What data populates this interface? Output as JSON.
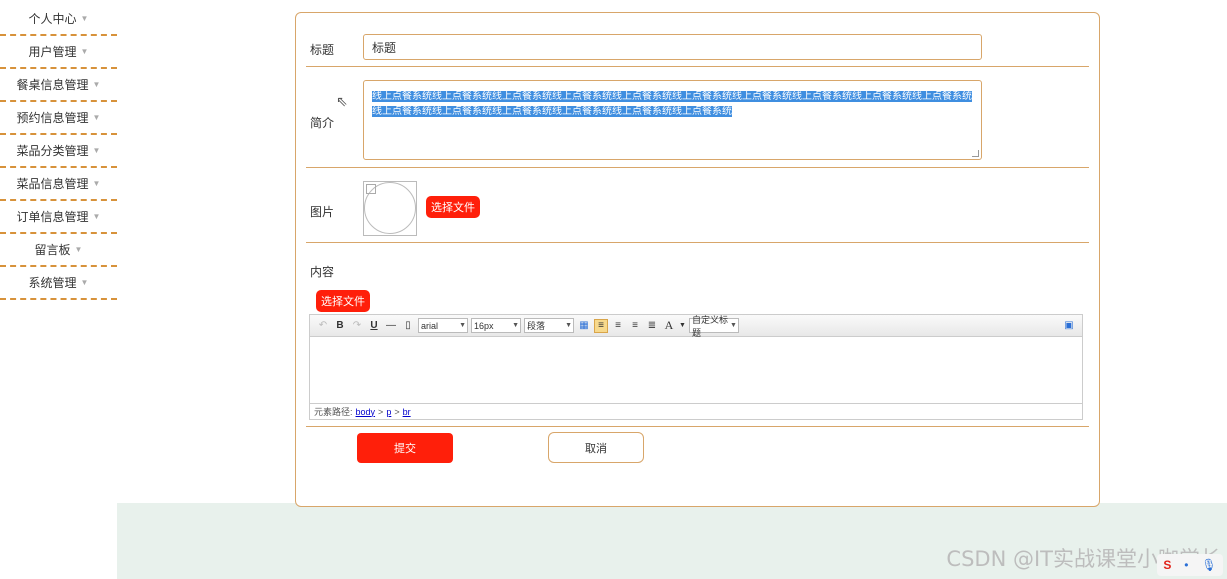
{
  "sidebar": {
    "items": [
      {
        "label": "个人中心"
      },
      {
        "label": "用户管理"
      },
      {
        "label": "餐桌信息管理"
      },
      {
        "label": "预约信息管理"
      },
      {
        "label": "菜品分类管理"
      },
      {
        "label": "菜品信息管理"
      },
      {
        "label": "订单信息管理"
      },
      {
        "label": "留言板"
      },
      {
        "label": "系统管理"
      }
    ]
  },
  "form": {
    "title": {
      "label": "标题",
      "value": "标题"
    },
    "intro": {
      "label": "简介",
      "value": "线上点餐系统线上点餐系统线上点餐系统线上点餐系统线上点餐系统线上点餐系统线上点餐系统线上点餐系统线上点餐系统线上点餐系统线上点餐系统线上点餐系统线上点餐系统线上点餐系统线上点餐系统线上点餐系统"
    },
    "image": {
      "label": "图片",
      "choose_label": "选择文件"
    },
    "content": {
      "label": "内容",
      "choose_label": "选择文件"
    }
  },
  "editor": {
    "font": "arial",
    "size": "16px",
    "paragraph": "段落",
    "custom_title": "自定义标题",
    "path_label": "元素路径:",
    "path": [
      "body",
      "p",
      "br"
    ]
  },
  "actions": {
    "submit": "提交",
    "cancel": "取消"
  },
  "watermark": "CSDN @IT实战课堂小咖学长",
  "colors": {
    "accent": "#ff1f0a",
    "border": "#d8a66a",
    "selection": "#3f8ee0",
    "footer": "#e8f1ec"
  }
}
